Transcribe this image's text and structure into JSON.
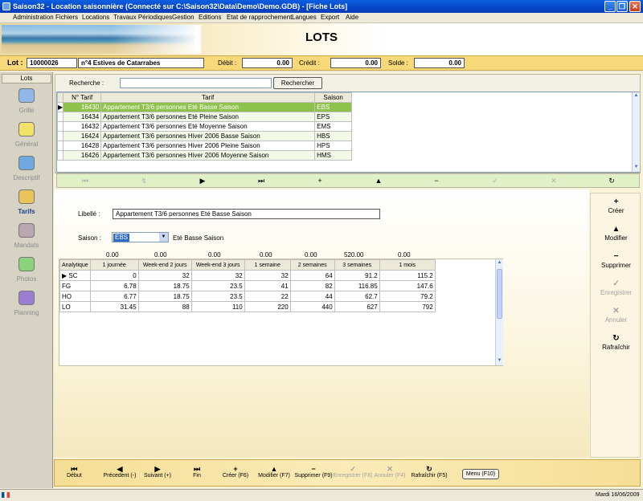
{
  "window": {
    "title": "Saison32 - Location saisonnière (Connecté sur C:\\Saison32\\Data\\Demo\\Demo.GDB) - [Fiche Lots]",
    "controls": [
      "_",
      "❐",
      "✕"
    ]
  },
  "menu": [
    "Administration",
    "Fichiers",
    "Locations",
    "Travaux Périodiques",
    "Gestion",
    "Editions",
    "Etat de rapprochement",
    "Langues",
    "Export",
    "Aide"
  ],
  "page_title": "LOTS",
  "lot_bar": {
    "lot_label": "Lot :",
    "lot_number": "10000026",
    "lot_name": "n°4 Estives de Catarrabes",
    "debit_label": "Débit :",
    "debit_value": "0.00",
    "credit_label": "Crédit :",
    "credit_value": "0.00",
    "solde_label": "Solde :",
    "solde_value": "0.00"
  },
  "sidebar": {
    "header": "Lots",
    "items": [
      {
        "label": "Grille",
        "color": "#8FB8E8"
      },
      {
        "label": "Général",
        "color": "#F2E26A"
      },
      {
        "label": "Descriptif",
        "color": "#6FA8E0"
      },
      {
        "label": "Tarifs",
        "color": "#E8C45A"
      },
      {
        "label": "Mandats",
        "color": "#B8A8B0"
      },
      {
        "label": "Photos",
        "color": "#8CD27C"
      },
      {
        "label": "Planning",
        "color": "#9A7FD0"
      }
    ],
    "active": "Tarifs"
  },
  "search": {
    "label": "Recherche :",
    "value": "",
    "button": "Rechercher"
  },
  "tarif_table": {
    "columns": [
      "N° Tarif",
      "Tarif",
      "Saison"
    ],
    "rows": [
      {
        "num": "16430",
        "tarif": "Appartement T3/6 personnes Eté Basse Saison",
        "saison": "EBS"
      },
      {
        "num": "16434",
        "tarif": "Appartement T3/6 personnes Eté Pleine Saison",
        "saison": "EPS"
      },
      {
        "num": "16432",
        "tarif": "Appartement T3/6 personnes Eté Moyenne Saison",
        "saison": "EMS"
      },
      {
        "num": "16424",
        "tarif": "Appartement T3/6 personnes Hiver 2006 Basse Saison",
        "saison": "HBS"
      },
      {
        "num": "16428",
        "tarif": "Appartement T3/6 personnes Hiver 2006 Pleine Saison",
        "saison": "HPS"
      },
      {
        "num": "16426",
        "tarif": "Appartement T3/6 personnes Hiver 2006 Moyenne Saison",
        "saison": "HMS"
      }
    ]
  },
  "navigator": [
    "⏮",
    "↯",
    "▶",
    "⏭",
    "+",
    "▲",
    "−",
    "✓",
    "✕",
    "↻"
  ],
  "detail": {
    "libelle_label": "Libellé :",
    "libelle_value": "Appartement T3/6 personnes Eté Basse Saison",
    "saison_label": "Saison :",
    "saison_value": "EBS",
    "saison_desc": "Eté Basse Saison",
    "totals": [
      "0.00",
      "0.00",
      "0.00",
      "0.00",
      "0.00",
      "520.00",
      "0.00"
    ],
    "grid_headers": [
      "Analytique",
      "1 journée",
      "Week-end 2 jours",
      "Week-end 3 jours",
      "1 semaine",
      "2 semaines",
      "3 semaines",
      "1 mois"
    ],
    "grid_rows": [
      [
        "SC",
        "0",
        "32",
        "32",
        "32",
        "64",
        "91.2",
        "115.2"
      ],
      [
        "FG",
        "6.78",
        "18.75",
        "23.5",
        "41",
        "82",
        "116.85",
        "147.6"
      ],
      [
        "HO",
        "6.77",
        "18.75",
        "23.5",
        "22",
        "44",
        "62.7",
        "79.2"
      ],
      [
        "LO",
        "31.45",
        "88",
        "110",
        "220",
        "440",
        "627",
        "792"
      ]
    ]
  },
  "actions": [
    {
      "label": "Créer",
      "glyph": "+",
      "enabled": true
    },
    {
      "label": "Modifier",
      "glyph": "▲",
      "enabled": true
    },
    {
      "label": "Supprimer",
      "glyph": "−",
      "enabled": true
    },
    {
      "label": "Enregistrer",
      "glyph": "✓",
      "enabled": false
    },
    {
      "label": "Annuler",
      "glyph": "✕",
      "enabled": false
    },
    {
      "label": "Rafraîchir",
      "glyph": "↻",
      "enabled": true
    }
  ],
  "bottom_buttons": [
    {
      "label": "Début",
      "glyph": "⏮",
      "enabled": true
    },
    {
      "label": "Précedent (-)",
      "glyph": "◀",
      "enabled": true
    },
    {
      "label": "Suivant (+)",
      "glyph": "▶",
      "enabled": true
    },
    {
      "label": "Fin",
      "glyph": "⏭",
      "enabled": true
    },
    {
      "label": "Créer (F6)",
      "glyph": "+",
      "enabled": true
    },
    {
      "label": "Modifier (F7)",
      "glyph": "▲",
      "enabled": true
    },
    {
      "label": "Supprimer (F9)",
      "glyph": "−",
      "enabled": true
    },
    {
      "label": "Enregistrer (F8)",
      "glyph": "✓",
      "enabled": false
    },
    {
      "label": "Annuler (F4)",
      "glyph": "✕",
      "enabled": false
    },
    {
      "label": "Rafraîchir (F5)",
      "glyph": "↻",
      "enabled": true
    }
  ],
  "menu_button": "Menu (F10)",
  "status": {
    "date": "Mardi 16/06/2009"
  }
}
